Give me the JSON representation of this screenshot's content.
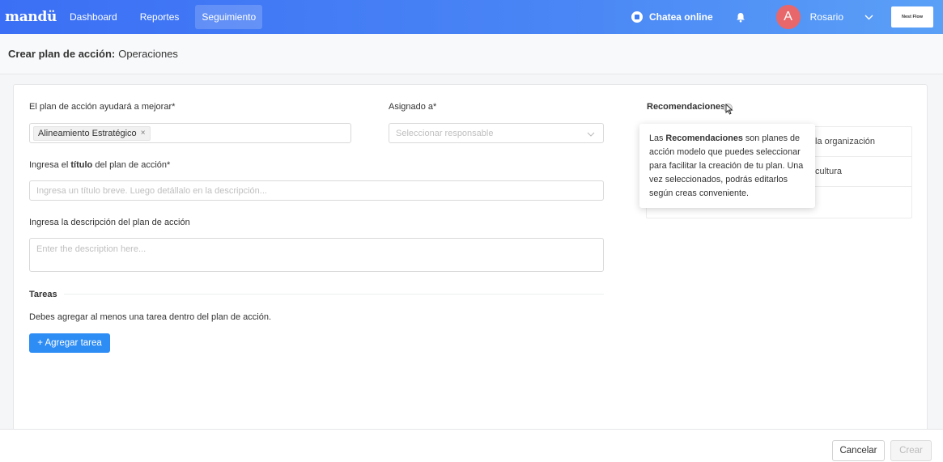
{
  "nav": {
    "logo": "mandü",
    "items": [
      {
        "label": "Dashboard",
        "active": false
      },
      {
        "label": "Reportes",
        "active": false
      },
      {
        "label": "Seguimiento",
        "active": true
      }
    ],
    "chat_label": "Chatea online",
    "user_initial": "A",
    "user_name": "Rosario",
    "brand_text": "Nest Flow",
    "icons": [
      "chat-icon",
      "bell-icon",
      "chevron-down-icon"
    ]
  },
  "header": {
    "title_bold": "Crear plan de acción:",
    "title_rest": "Operaciones"
  },
  "form": {
    "improve_label": "El plan de acción ayudará a mejorar*",
    "improve_tag": "Alineamiento Estratégico",
    "tag_remove": "×",
    "assigned_label": "Asignado a*",
    "assigned_placeholder": "Seleccionar responsable",
    "title_label_pre": "Ingresa el",
    "title_label_bold": "título",
    "title_label_post": "del plan de acción*",
    "title_placeholder": "Ingresa un título breve. Luego detállalo en la descripción...",
    "desc_label": "Ingresa la descripción del plan de acción",
    "desc_placeholder": "Enter the description here...",
    "tasks_title": "Tareas",
    "tasks_hint": "Debes agregar al menos una tarea dentro del plan de acción.",
    "add_task": "+ Agregar tarea"
  },
  "recommendations": {
    "title": "Recomendaciones",
    "items": [
      "la organización",
      "cultura",
      ""
    ],
    "tooltip_pre": "Las",
    "tooltip_bold": "Recomendaciones",
    "tooltip_post": "son planes de acción modelo que puedes seleccionar para facilitar la creación de tu plan. Una vez seleccionados, podrás editarlos según creas conveniente."
  },
  "footer": {
    "cancel": "Cancelar",
    "create": "Crear"
  }
}
